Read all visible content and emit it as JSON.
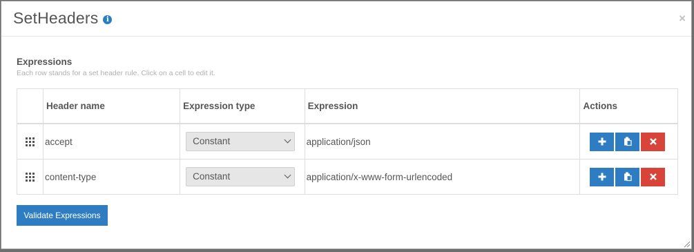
{
  "modal": {
    "title": "SetHeaders",
    "info_icon": "info-icon",
    "close_icon": "×"
  },
  "section": {
    "title": "Expressions",
    "description": "Each row stands for a set header rule. Click on a cell to edit it."
  },
  "table": {
    "headers": {
      "name": "Header name",
      "type": "Expression type",
      "expression": "Expression",
      "actions": "Actions"
    },
    "rows": [
      {
        "name": "accept",
        "type": "Constant",
        "expression": "application/json"
      },
      {
        "name": "content-type",
        "type": "Constant",
        "expression": "application/x-www-form-urlencoded"
      }
    ]
  },
  "actions": {
    "add_icon": "plus-icon",
    "paste_icon": "clipboard-icon",
    "delete_icon": "close-icon"
  },
  "footer": {
    "validate_label": "Validate Expressions"
  },
  "colors": {
    "primary": "#2e7dc2",
    "danger": "#d9443a"
  }
}
